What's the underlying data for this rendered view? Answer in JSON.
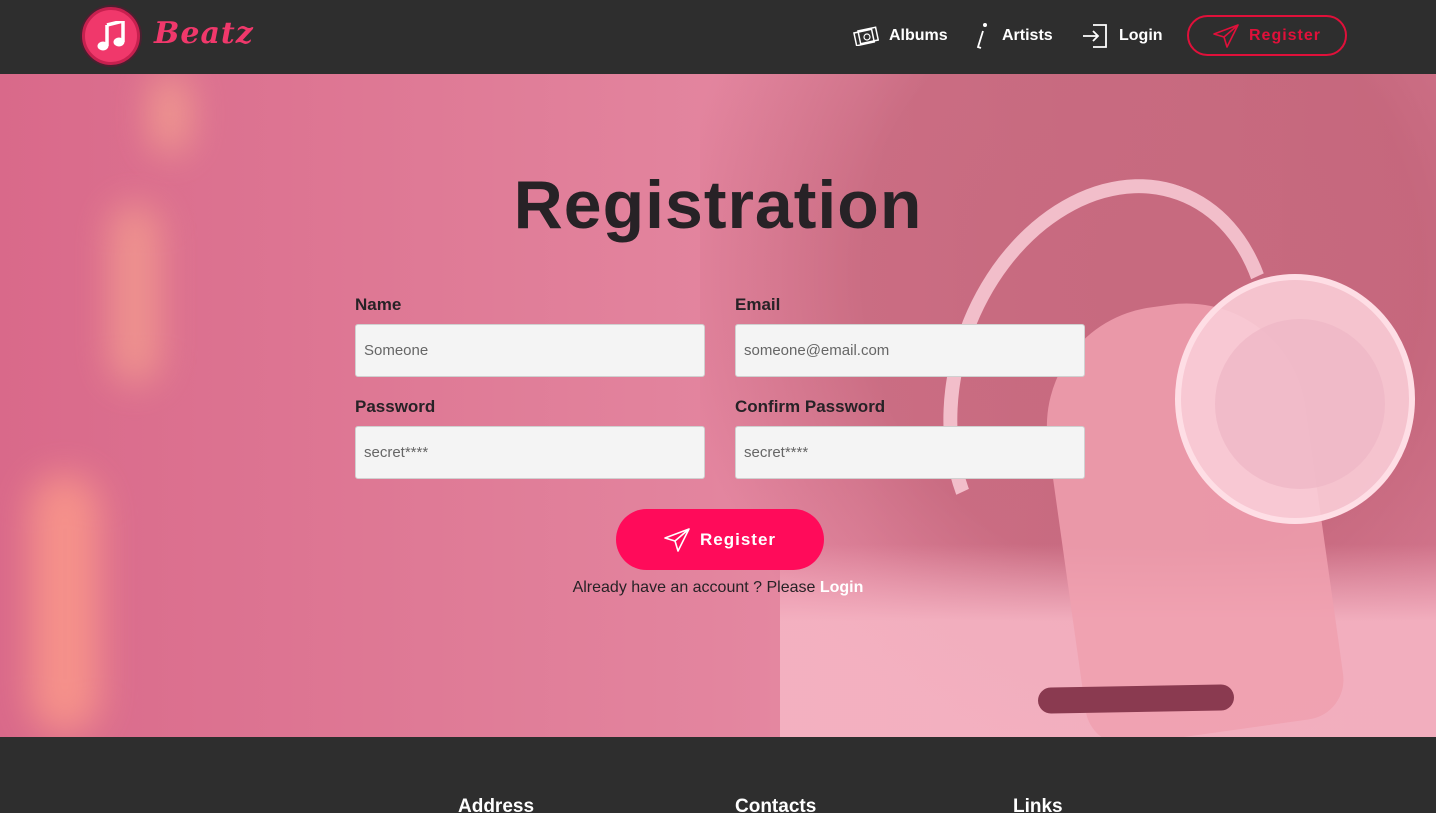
{
  "brand": {
    "name": "Beatz",
    "accent": "#f0386b"
  },
  "nav": {
    "albums": "Albums",
    "artists": "Artists",
    "login": "Login",
    "register": "Register"
  },
  "form": {
    "title": "Registration",
    "name_label": "Name",
    "name_placeholder": "Someone",
    "email_label": "Email",
    "email_placeholder": "someone@email.com",
    "password_label": "Password",
    "password_placeholder": "secret****",
    "confirm_label": "Confirm Password",
    "confirm_placeholder": "secret****",
    "submit_label": "Register",
    "login_prompt": "Already have an account ? Please",
    "login_link": "Login",
    "button_color": "#ff0b5a"
  },
  "footer": {
    "address": "Address",
    "contacts": "Contacts",
    "links": "Links"
  },
  "icons": [
    "music-note-icon",
    "albums-icon",
    "info-icon",
    "login-icon",
    "send-icon"
  ]
}
